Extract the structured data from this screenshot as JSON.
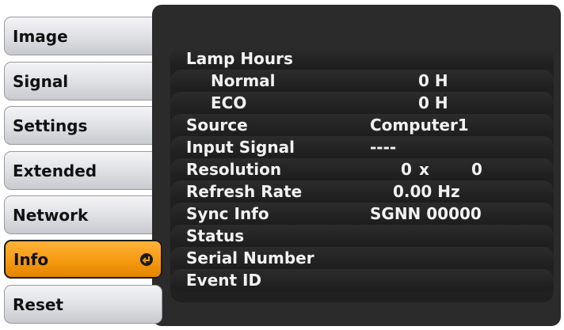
{
  "menu": {
    "items": [
      {
        "label": "Image"
      },
      {
        "label": "Signal"
      },
      {
        "label": "Settings"
      },
      {
        "label": "Extended"
      },
      {
        "label": "Network"
      },
      {
        "label": "Info",
        "selected": true
      },
      {
        "label": "Reset"
      }
    ]
  },
  "info": {
    "lamp_hours": {
      "label": "Lamp Hours"
    },
    "normal": {
      "label": "Normal",
      "value": "0 H"
    },
    "eco": {
      "label": "ECO",
      "value": "0 H"
    },
    "source": {
      "label": "Source",
      "value": "Computer1"
    },
    "input_signal": {
      "label": "Input Signal",
      "value": "----"
    },
    "resolution": {
      "label": "Resolution",
      "width": "0",
      "x": "x",
      "height": "0"
    },
    "refresh_rate": {
      "label": "Refresh Rate",
      "value": "0.00 Hz"
    },
    "sync_info": {
      "label": "Sync Info",
      "value": "SGNN 00000"
    },
    "status": {
      "label": "Status"
    },
    "serial_number": {
      "label": "Serial Number"
    },
    "event_id": {
      "label": "Event ID"
    }
  },
  "colors": {
    "selected_tab": "#f59a10",
    "panel_bg": "#2b2b2b",
    "text": "#f2f2f2"
  }
}
